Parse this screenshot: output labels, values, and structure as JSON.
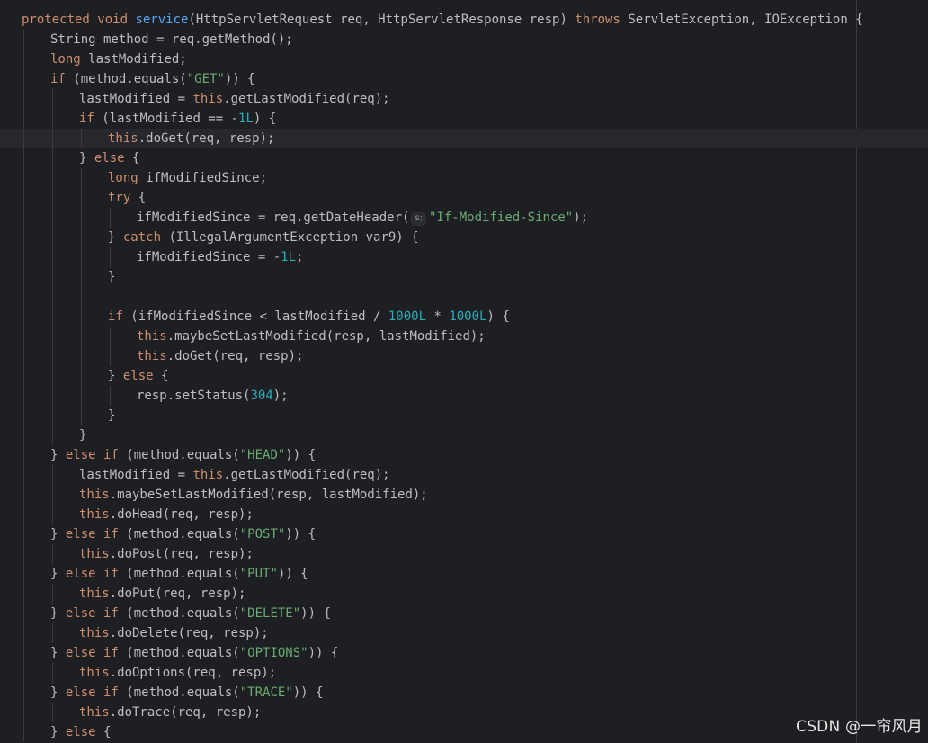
{
  "editor": {
    "theme_colors": {
      "background": "#1e1f22",
      "text": "#bcbec4",
      "keyword": "#cf8e6d",
      "method_declaration": "#56a8f5",
      "this_member": "#c77dbb",
      "string": "#6aab73",
      "number": "#2aacb8",
      "current_line": "#26282e"
    },
    "current_line_index": 6,
    "lines": [
      {
        "indent": 0,
        "tokens": [
          [
            "kw",
            "protected void "
          ],
          [
            "fn",
            "service"
          ],
          [
            "p",
            "(HttpServletRequest req, HttpServletResponse resp) "
          ],
          [
            "kw",
            "throws "
          ],
          [
            "p",
            "ServletException, IOException {"
          ]
        ]
      },
      {
        "indent": 1,
        "tokens": [
          [
            "p",
            "String method = req.getMethod();"
          ]
        ]
      },
      {
        "indent": 1,
        "tokens": [
          [
            "kw",
            "long "
          ],
          [
            "p",
            "lastModified;"
          ]
        ]
      },
      {
        "indent": 1,
        "tokens": [
          [
            "kw",
            "if "
          ],
          [
            "p",
            "(method.equals("
          ],
          [
            "str",
            "\"GET\""
          ],
          [
            "p",
            ")) {"
          ]
        ]
      },
      {
        "indent": 2,
        "tokens": [
          [
            "p",
            "lastModified = "
          ],
          [
            "kw",
            "this"
          ],
          [
            "p",
            ".getLastModified(req);"
          ]
        ]
      },
      {
        "indent": 2,
        "tokens": [
          [
            "kw",
            "if "
          ],
          [
            "p",
            "(lastModified == -"
          ],
          [
            "num",
            "1L"
          ],
          [
            "p",
            ") {"
          ]
        ]
      },
      {
        "indent": 3,
        "tokens": [
          [
            "kw",
            "this"
          ],
          [
            "p",
            ".doGet(req, resp);"
          ]
        ]
      },
      {
        "indent": 2,
        "tokens": [
          [
            "p",
            "} "
          ],
          [
            "kw",
            "else "
          ],
          [
            "p",
            "{"
          ]
        ]
      },
      {
        "indent": 3,
        "tokens": [
          [
            "kw",
            "long "
          ],
          [
            "p",
            "ifModifiedSince;"
          ]
        ]
      },
      {
        "indent": 3,
        "tokens": [
          [
            "kw",
            "try "
          ],
          [
            "p",
            "{"
          ]
        ]
      },
      {
        "indent": 4,
        "tokens": [
          [
            "p",
            "ifModifiedSince = req.getDateHeader("
          ],
          [
            "hint",
            "s:"
          ],
          [
            "str",
            "\"If-Modified-Since\""
          ],
          [
            "p",
            ");"
          ]
        ]
      },
      {
        "indent": 3,
        "tokens": [
          [
            "p",
            "} "
          ],
          [
            "kw",
            "catch "
          ],
          [
            "p",
            "(IllegalArgumentException var9) {"
          ]
        ]
      },
      {
        "indent": 4,
        "tokens": [
          [
            "p",
            "ifModifiedSince = -"
          ],
          [
            "num",
            "1L"
          ],
          [
            "p",
            ";"
          ]
        ]
      },
      {
        "indent": 3,
        "tokens": [
          [
            "p",
            "}"
          ]
        ]
      },
      {
        "indent": 3,
        "tokens": []
      },
      {
        "indent": 3,
        "tokens": [
          [
            "kw",
            "if "
          ],
          [
            "p",
            "(ifModifiedSince < lastModified / "
          ],
          [
            "num",
            "1000L"
          ],
          [
            "p",
            " * "
          ],
          [
            "num",
            "1000L"
          ],
          [
            "p",
            ") {"
          ]
        ]
      },
      {
        "indent": 4,
        "tokens": [
          [
            "kw",
            "this"
          ],
          [
            "p",
            ".maybeSetLastModified(resp, lastModified);"
          ]
        ]
      },
      {
        "indent": 4,
        "tokens": [
          [
            "kw",
            "this"
          ],
          [
            "p",
            ".doGet(req, resp);"
          ]
        ]
      },
      {
        "indent": 3,
        "tokens": [
          [
            "p",
            "} "
          ],
          [
            "kw",
            "else "
          ],
          [
            "p",
            "{"
          ]
        ]
      },
      {
        "indent": 4,
        "tokens": [
          [
            "p",
            "resp.setStatus("
          ],
          [
            "num",
            "304"
          ],
          [
            "p",
            ");"
          ]
        ]
      },
      {
        "indent": 3,
        "tokens": [
          [
            "p",
            "}"
          ]
        ]
      },
      {
        "indent": 2,
        "tokens": [
          [
            "p",
            "}"
          ]
        ]
      },
      {
        "indent": 1,
        "tokens": [
          [
            "p",
            "} "
          ],
          [
            "kw",
            "else if "
          ],
          [
            "p",
            "(method.equals("
          ],
          [
            "str",
            "\"HEAD\""
          ],
          [
            "p",
            ")) {"
          ]
        ]
      },
      {
        "indent": 2,
        "tokens": [
          [
            "p",
            "lastModified = "
          ],
          [
            "kw",
            "this"
          ],
          [
            "p",
            ".getLastModified(req);"
          ]
        ]
      },
      {
        "indent": 2,
        "tokens": [
          [
            "kw",
            "this"
          ],
          [
            "p",
            ".maybeSetLastModified(resp, lastModified);"
          ]
        ]
      },
      {
        "indent": 2,
        "tokens": [
          [
            "kw",
            "this"
          ],
          [
            "p",
            ".doHead(req, resp);"
          ]
        ]
      },
      {
        "indent": 1,
        "tokens": [
          [
            "p",
            "} "
          ],
          [
            "kw",
            "else if "
          ],
          [
            "p",
            "(method.equals("
          ],
          [
            "str",
            "\"POST\""
          ],
          [
            "p",
            ")) {"
          ]
        ]
      },
      {
        "indent": 2,
        "tokens": [
          [
            "kw",
            "this"
          ],
          [
            "p",
            ".doPost(req, resp);"
          ]
        ]
      },
      {
        "indent": 1,
        "tokens": [
          [
            "p",
            "} "
          ],
          [
            "kw",
            "else if "
          ],
          [
            "p",
            "(method.equals("
          ],
          [
            "str",
            "\"PUT\""
          ],
          [
            "p",
            ")) {"
          ]
        ]
      },
      {
        "indent": 2,
        "tokens": [
          [
            "kw",
            "this"
          ],
          [
            "p",
            ".doPut(req, resp);"
          ]
        ]
      },
      {
        "indent": 1,
        "tokens": [
          [
            "p",
            "} "
          ],
          [
            "kw",
            "else if "
          ],
          [
            "p",
            "(method.equals("
          ],
          [
            "str",
            "\"DELETE\""
          ],
          [
            "p",
            ")) {"
          ]
        ]
      },
      {
        "indent": 2,
        "tokens": [
          [
            "kw",
            "this"
          ],
          [
            "p",
            ".doDelete(req, resp);"
          ]
        ]
      },
      {
        "indent": 1,
        "tokens": [
          [
            "p",
            "} "
          ],
          [
            "kw",
            "else if "
          ],
          [
            "p",
            "(method.equals("
          ],
          [
            "str",
            "\"OPTIONS\""
          ],
          [
            "p",
            ")) {"
          ]
        ]
      },
      {
        "indent": 2,
        "tokens": [
          [
            "kw",
            "this"
          ],
          [
            "p",
            ".doOptions(req, resp);"
          ]
        ]
      },
      {
        "indent": 1,
        "tokens": [
          [
            "p",
            "} "
          ],
          [
            "kw",
            "else if "
          ],
          [
            "p",
            "(method.equals("
          ],
          [
            "str",
            "\"TRACE\""
          ],
          [
            "p",
            ")) {"
          ]
        ]
      },
      {
        "indent": 2,
        "tokens": [
          [
            "kw",
            "this"
          ],
          [
            "p",
            ".doTrace(req, resp);"
          ]
        ]
      },
      {
        "indent": 1,
        "tokens": [
          [
            "p",
            "} "
          ],
          [
            "kw",
            "else "
          ],
          [
            "p",
            "{"
          ]
        ]
      }
    ]
  },
  "watermark": {
    "text": "CSDN @一帘风月"
  }
}
